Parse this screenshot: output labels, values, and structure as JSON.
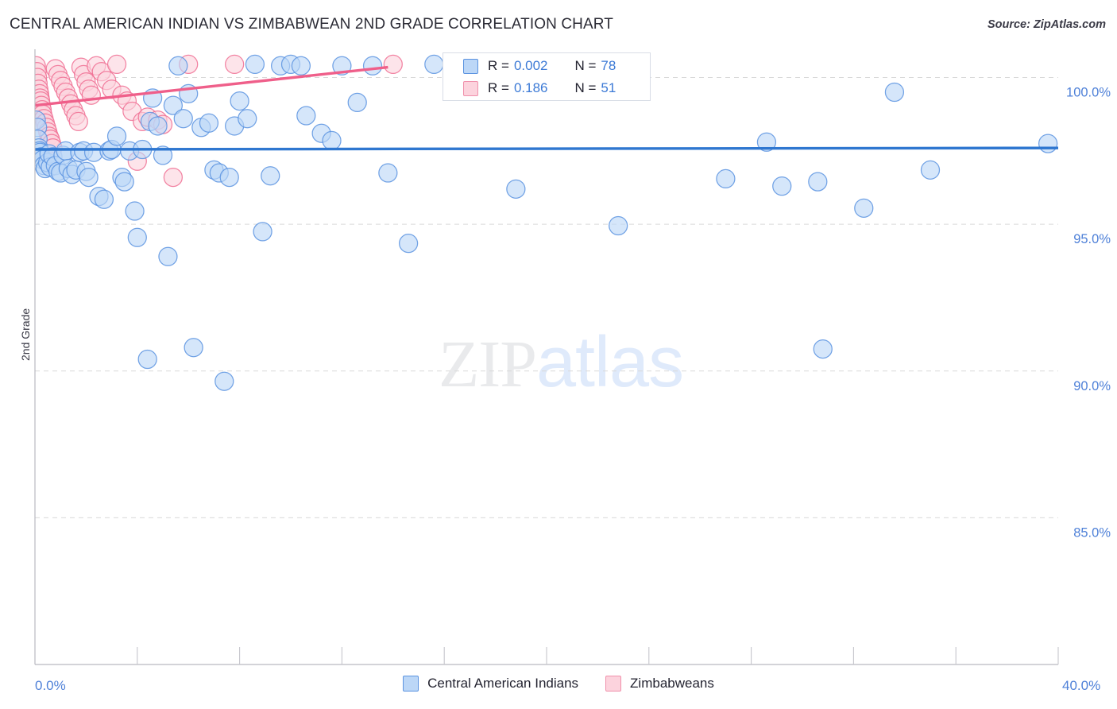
{
  "header": {
    "title": "CENTRAL AMERICAN INDIAN VS ZIMBABWEAN 2ND GRADE CORRELATION CHART",
    "source": "Source: ZipAtlas.com"
  },
  "watermark": {
    "part1": "ZIP",
    "part2": "atlas"
  },
  "stats_legend": {
    "rows": [
      {
        "series": "Central American Indians",
        "r_label": "R =",
        "r_value": "0.002",
        "n_label": "N =",
        "n_value": "78",
        "color": "#bcd7f7"
      },
      {
        "series": "Zimbabweans",
        "r_label": "R =",
        "r_value": "0.186",
        "n_label": "N =",
        "n_value": "51",
        "color": "#fcd3dd"
      }
    ]
  },
  "bottom_legend": {
    "items": [
      {
        "label": "Central American Indians",
        "color": "#bcd7f7"
      },
      {
        "label": "Zimbabweans",
        "color": "#fcd3dd"
      }
    ]
  },
  "chart_data": {
    "type": "scatter",
    "title": "CENTRAL AMERICAN INDIAN VS ZIMBABWEAN 2ND GRADE CORRELATION CHART",
    "xlabel": "",
    "ylabel": "2nd Grade",
    "xlim": [
      0,
      40
    ],
    "ylim": [
      80.0,
      100.8
    ],
    "grid": true,
    "x_axis": {
      "tick_labels": [
        "0.0%",
        "40.0%"
      ],
      "tick_values": [
        0,
        40
      ],
      "minor_ticks": [
        4,
        8,
        12,
        16,
        20,
        24,
        28,
        32,
        36
      ]
    },
    "y_axis": {
      "tick_labels": [
        "100.0%",
        "95.0%",
        "90.0%",
        "85.0%"
      ],
      "tick_values": [
        100.0,
        95.0,
        90.0,
        85.0
      ]
    },
    "legend_position": "bottom-center",
    "series": [
      {
        "name": "Central American Indians",
        "color": "#bcd7f7",
        "edge_color": "#5b93e0",
        "r": 0.002,
        "n": 78,
        "trendline": {
          "x0": 0,
          "y0": 97.55,
          "x1": 40,
          "y1": 97.6,
          "color": "#2f77d0"
        },
        "points": [
          [
            0.05,
            98.55
          ],
          [
            0.1,
            98.3
          ],
          [
            0.12,
            97.9
          ],
          [
            0.15,
            97.6
          ],
          [
            0.18,
            97.5
          ],
          [
            0.2,
            97.45
          ],
          [
            0.25,
            97.3
          ],
          [
            0.3,
            97.2
          ],
          [
            0.35,
            97.0
          ],
          [
            0.4,
            96.9
          ],
          [
            0.5,
            97.1
          ],
          [
            0.55,
            97.4
          ],
          [
            0.6,
            96.95
          ],
          [
            0.7,
            97.3
          ],
          [
            0.8,
            97.0
          ],
          [
            0.9,
            96.8
          ],
          [
            1.0,
            96.75
          ],
          [
            1.1,
            97.35
          ],
          [
            1.2,
            97.5
          ],
          [
            1.3,
            96.9
          ],
          [
            1.45,
            96.7
          ],
          [
            1.6,
            96.85
          ],
          [
            1.75,
            97.45
          ],
          [
            1.9,
            97.5
          ],
          [
            2.0,
            96.8
          ],
          [
            2.1,
            96.6
          ],
          [
            2.3,
            97.45
          ],
          [
            2.5,
            95.95
          ],
          [
            2.7,
            95.85
          ],
          [
            2.9,
            97.5
          ],
          [
            3.0,
            97.55
          ],
          [
            3.2,
            98.0
          ],
          [
            3.4,
            96.6
          ],
          [
            3.5,
            96.45
          ],
          [
            3.7,
            97.5
          ],
          [
            3.9,
            95.45
          ],
          [
            4.0,
            94.55
          ],
          [
            4.2,
            97.55
          ],
          [
            4.4,
            90.4
          ],
          [
            4.5,
            98.5
          ],
          [
            4.6,
            99.3
          ],
          [
            4.8,
            98.35
          ],
          [
            5.0,
            97.35
          ],
          [
            5.2,
            93.9
          ],
          [
            5.4,
            99.05
          ],
          [
            5.6,
            100.4
          ],
          [
            5.8,
            98.6
          ],
          [
            6.0,
            99.45
          ],
          [
            6.2,
            90.8
          ],
          [
            6.5,
            98.3
          ],
          [
            6.8,
            98.45
          ],
          [
            7.0,
            96.85
          ],
          [
            7.2,
            96.75
          ],
          [
            7.4,
            89.65
          ],
          [
            7.6,
            96.6
          ],
          [
            7.8,
            98.35
          ],
          [
            8.0,
            99.2
          ],
          [
            8.3,
            98.6
          ],
          [
            8.6,
            100.45
          ],
          [
            8.9,
            94.75
          ],
          [
            9.2,
            96.65
          ],
          [
            9.6,
            100.4
          ],
          [
            10.0,
            100.45
          ],
          [
            10.4,
            100.4
          ],
          [
            10.6,
            98.7
          ],
          [
            11.2,
            98.1
          ],
          [
            11.6,
            97.85
          ],
          [
            12.0,
            100.4
          ],
          [
            12.6,
            99.15
          ],
          [
            13.2,
            100.4
          ],
          [
            13.8,
            96.75
          ],
          [
            14.6,
            94.35
          ],
          [
            15.6,
            100.45
          ],
          [
            18.8,
            96.2
          ],
          [
            22.8,
            94.95
          ],
          [
            27.0,
            96.55
          ],
          [
            28.6,
            97.8
          ],
          [
            29.2,
            96.3
          ],
          [
            30.6,
            96.45
          ],
          [
            30.8,
            90.75
          ],
          [
            32.4,
            95.55
          ],
          [
            33.6,
            99.5
          ],
          [
            35.0,
            96.85
          ],
          [
            39.6,
            97.75
          ]
        ]
      },
      {
        "name": "Zimbabweans",
        "color": "#fcd3dd",
        "edge_color": "#f06f93",
        "r": 0.186,
        "n": 51,
        "trendline": {
          "x0": 0,
          "y0": 99.05,
          "x1": 13.8,
          "y1": 100.35,
          "color": "#ef5f8a"
        },
        "points": [
          [
            0.05,
            100.4
          ],
          [
            0.08,
            100.2
          ],
          [
            0.1,
            100.0
          ],
          [
            0.12,
            99.8
          ],
          [
            0.15,
            99.6
          ],
          [
            0.18,
            99.45
          ],
          [
            0.2,
            99.3
          ],
          [
            0.22,
            99.2
          ],
          [
            0.25,
            99.05
          ],
          [
            0.28,
            98.9
          ],
          [
            0.3,
            98.75
          ],
          [
            0.35,
            98.6
          ],
          [
            0.4,
            98.45
          ],
          [
            0.45,
            98.3
          ],
          [
            0.5,
            98.15
          ],
          [
            0.55,
            98.0
          ],
          [
            0.6,
            97.9
          ],
          [
            0.65,
            97.75
          ],
          [
            0.7,
            97.6
          ],
          [
            0.8,
            100.3
          ],
          [
            0.9,
            100.1
          ],
          [
            1.0,
            99.9
          ],
          [
            1.1,
            99.7
          ],
          [
            1.2,
            99.5
          ],
          [
            1.3,
            99.3
          ],
          [
            1.4,
            99.1
          ],
          [
            1.5,
            98.9
          ],
          [
            1.6,
            98.7
          ],
          [
            1.7,
            98.5
          ],
          [
            1.8,
            100.35
          ],
          [
            1.9,
            100.1
          ],
          [
            2.0,
            99.85
          ],
          [
            2.1,
            99.6
          ],
          [
            2.2,
            99.4
          ],
          [
            2.4,
            100.4
          ],
          [
            2.6,
            100.2
          ],
          [
            2.8,
            99.9
          ],
          [
            3.0,
            99.6
          ],
          [
            3.2,
            100.45
          ],
          [
            3.4,
            99.4
          ],
          [
            3.6,
            99.2
          ],
          [
            3.8,
            98.85
          ],
          [
            4.0,
            97.15
          ],
          [
            4.2,
            98.5
          ],
          [
            4.4,
            98.65
          ],
          [
            4.8,
            98.55
          ],
          [
            5.0,
            98.4
          ],
          [
            5.4,
            96.6
          ],
          [
            6.0,
            100.45
          ],
          [
            7.8,
            100.45
          ],
          [
            14.0,
            100.45
          ]
        ]
      }
    ]
  }
}
